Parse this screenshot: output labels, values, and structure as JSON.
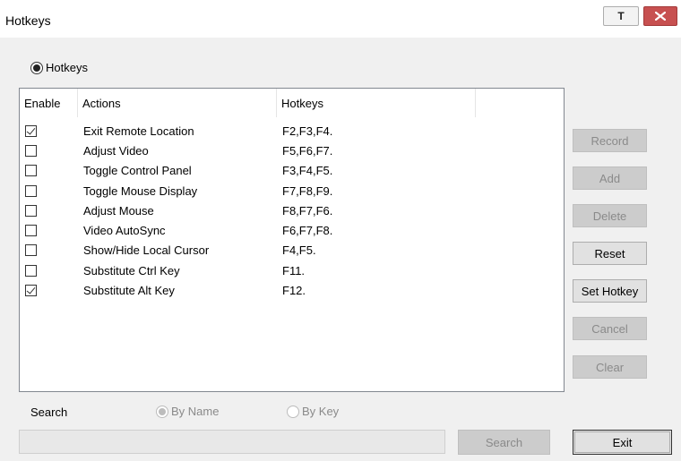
{
  "window": {
    "title": "Hotkeys",
    "pin_label": "T",
    "close_color": "#c75050"
  },
  "mode_radio": {
    "label": "Hotkeys",
    "checked": true
  },
  "table": {
    "headers": [
      "Enable",
      "Actions",
      "Hotkeys",
      ""
    ],
    "rows": [
      {
        "enabled": true,
        "action": "Exit Remote Location",
        "hotkey": "F2,F3,F4."
      },
      {
        "enabled": false,
        "action": "Adjust Video",
        "hotkey": "F5,F6,F7."
      },
      {
        "enabled": false,
        "action": "Toggle Control Panel",
        "hotkey": "F3,F4,F5."
      },
      {
        "enabled": false,
        "action": "Toggle Mouse Display",
        "hotkey": "F7,F8,F9."
      },
      {
        "enabled": false,
        "action": "Adjust Mouse",
        "hotkey": "F8,F7,F6."
      },
      {
        "enabled": false,
        "action": "Video AutoSync",
        "hotkey": "F6,F7,F8."
      },
      {
        "enabled": false,
        "action": "Show/Hide Local Cursor",
        "hotkey": "F4,F5."
      },
      {
        "enabled": false,
        "action": "Substitute Ctrl Key",
        "hotkey": "F11."
      },
      {
        "enabled": true,
        "action": "Substitute Alt Key",
        "hotkey": "F12."
      }
    ]
  },
  "side_buttons": {
    "record": "Record",
    "add": "Add",
    "delete": "Delete",
    "reset": "Reset",
    "set_hotkey": "Set Hotkey",
    "cancel": "Cancel",
    "clear": "Clear"
  },
  "search": {
    "label": "Search",
    "by_name": "By Name",
    "by_key": "By Key",
    "input_value": "",
    "button": "Search"
  },
  "exit_label": "Exit"
}
